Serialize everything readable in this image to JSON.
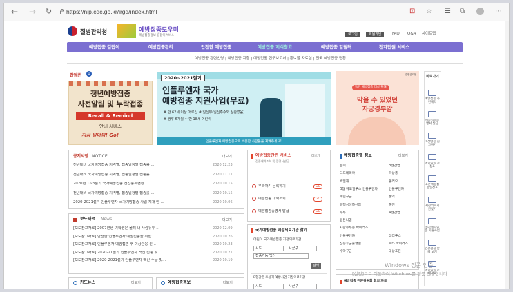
{
  "browser": {
    "url": "https://nip.cdc.go.kr/irgd/index.html"
  },
  "header": {
    "kdca_name": "질병관리청",
    "site_name": "예방접종도우미",
    "site_sub": "예방접종정보 길잡이서비스",
    "links": [
      "로그인",
      "회원가입",
      "FAQ",
      "Q&A",
      "사이트맵"
    ]
  },
  "nav": [
    "예방접종 길잡이",
    "예방접종관리",
    "안전한 예방접종",
    "예방접종 지식창고",
    "예방접종 알림터",
    "전자민원 서비스"
  ],
  "subnav": "예방접종 관련법령 | 예방접종 지침 | 예방접종 연구보고서 | 홍보물 자료실 | 전국 예방접종 현황",
  "popup": {
    "label": "팝업존",
    "title1": "청년예방접종",
    "title2": "사전알림 및 누락접종",
    "recall": "Recall & Remind",
    "guide": "안내 서비스",
    "script": "지금 알아봐! Go!"
  },
  "banner": {
    "badge": "2020~2021절기",
    "t1": "인플루엔자 국가",
    "t2": "예방접종 지원사업(무료)",
    "l1": "# 만 62세 이상 어르신 # 임신부(임신주수와 상관없음)",
    "l2": "# 생후 6개월 ~ 만 18세 어린이",
    "pill": "인플루엔자 예방접종으로 소중한 사람들을 지켜주세요!"
  },
  "rbanner": {
    "logo": "질병관리청",
    "pill": "독감 예방접종 대상 확대",
    "t1": "막을 수 있었던",
    "t2": "자궁경부암"
  },
  "notice": {
    "title": "공지사항",
    "title_en": "NOTICE",
    "more": "더보기",
    "rows": [
      {
        "t": "전년대비 국가예방접종 지역별, 접종일정별 접종률 ...",
        "d": "2020.12.23"
      },
      {
        "t": "전년대비 국가예방접종 지역별, 접종일정별 접종률 ...",
        "d": "2020.11.11"
      },
      {
        "t": "2020년 1~3분기 국가예방접종 전산등록현황",
        "d": "2020.10.15"
      },
      {
        "t": "전년대비 국가예방접종 지역별, 접종일정별 접종률 ...",
        "d": "2020.10.15"
      },
      {
        "t": "2020-2021절기 인플루엔자 국가예방접종 사업 재개 안 ...",
        "d": "2020.10.06"
      }
    ]
  },
  "press": {
    "title": "보도자료",
    "title_en": "News",
    "more": "더보기",
    "rows": [
      {
        "t": "[보도참고자료] 2007년생 여학생은 올해 내 사람유두 ...",
        "d": "2020.12.09"
      },
      {
        "t": "[보도참고자료] 안전한 인플루엔자 예방접종을 위한 ...",
        "d": "2020.10.26"
      },
      {
        "t": "[보도참고자료] 인플루엔자 예방접종 후 이상반응 신...",
        "d": "2020.10.23"
      },
      {
        "t": "[보도참고자료] 2020-21절기 인플루엔자 백신 접종 및 ...",
        "d": "2020.10.21"
      },
      {
        "t": "[보도참고자료] 2020-2021절기 인플루엔자 백신 수급 및...",
        "d": "2020.10.19"
      }
    ]
  },
  "cardnews": {
    "title": "카드뉴스",
    "more": "더보기"
  },
  "promo": {
    "title": "예방접종홍보",
    "more": "더보기"
  },
  "service": {
    "title": "예방접종관련 서비스",
    "sub": "접종내역조회 및 증명서발급",
    "more": "더보기",
    "items": [
      {
        "t": "우리아기 등록하기",
        "b": "GO"
      },
      {
        "t": "예방접종 내역조회",
        "b": "GO"
      },
      {
        "t": "예방접종증명서 발급",
        "b": "GO"
      }
    ]
  },
  "clinic": {
    "title": "국가예방접종 지정의료기관 찾기",
    "r1": "어린이 국가예방접종 지정의료기관",
    "sido": "시도",
    "sigungu": "시군구",
    "vaccine": "접종가능 백신",
    "search": "검색",
    "r2": "B형간염 주산기 예방사업 지정의료기관"
  },
  "info": {
    "title": "예방접종별 정보",
    "more": "더보기",
    "col1": [
      "결핵",
      "디프테리아",
      "백일해",
      "B형 헤모필루스 인플루엔자",
      "폐렴구균",
      "유행성이하선염",
      "수두",
      "일본뇌염",
      "사람유두종 바이러스",
      "인플루엔자",
      "신증후군출혈열",
      "수막구균"
    ],
    "col2": [
      "B형간염",
      "파상풍",
      "폴리오",
      "인플루엔자",
      "홍역",
      "풍진",
      "A형간염",
      "",
      "",
      "장티푸스",
      "로타 바이러스",
      "대상포진"
    ]
  },
  "expert": {
    "title": "예방접종 전문위원회 회의 자료"
  },
  "quick": {
    "title": "바로가기",
    "items": [
      "예방접종 사전예약",
      "예방접종증명서 발급",
      "이상반응 신고하기",
      "예방접종 일정표",
      "표준예방접종일정표",
      "지정의료기관찾기",
      "국가예방접종 지원사업",
      "건강검진 함께 보기",
      "예방접종 안내자료"
    ]
  },
  "watermark": {
    "l1": "Windows 정품 인증",
    "l2": "[설정]으로 이동하여 Windows를 정품 인증합니다."
  }
}
